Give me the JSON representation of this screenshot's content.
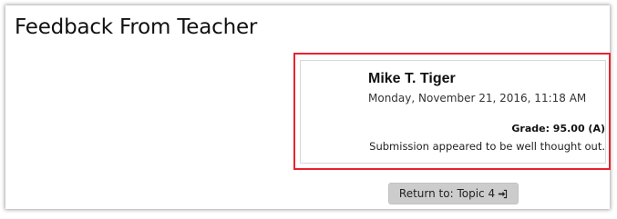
{
  "page": {
    "title": "Feedback From Teacher"
  },
  "feedback": {
    "teacher_name": "Mike T. Tiger",
    "date": "Monday, November 21, 2016, 11:18 AM",
    "grade": "Grade: 95.00 (A)",
    "comment": "Submission appeared to be well thought out."
  },
  "navigation": {
    "return_label": "Return to: Topic 4",
    "return_icon": "sign-in-icon"
  },
  "colors": {
    "highlight": "#e8232e",
    "button_bg": "#cccccc"
  }
}
